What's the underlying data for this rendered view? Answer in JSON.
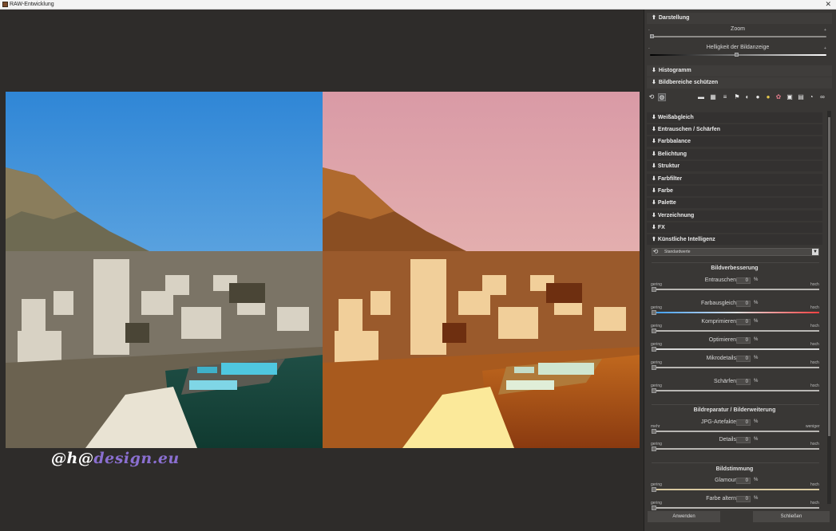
{
  "window": {
    "title": "RAW-Entwicklung",
    "close_glyph": "✕"
  },
  "watermark": {
    "part1": "@h@",
    "part2": "design.eu"
  },
  "sections": {
    "darstellung": "Darstellung",
    "zoom_label": "Zoom",
    "zoom_min": "-",
    "zoom_max": "+",
    "helligkeit_label": "Helligkeit der Bildanzeige",
    "hell_min": "-",
    "hell_max": "+",
    "histogramm": "Histogramm",
    "schuetzen": "Bildbereiche schützen"
  },
  "toolbar_icons": [
    "undo-icon",
    "settings-icon",
    "stripe-icon",
    "crop-icon",
    "lines-icon",
    "flag-icon",
    "contrast-icon",
    "color-icon",
    "sun-icon",
    "palette-icon",
    "camera-icon",
    "image-icon",
    "chat-icon",
    "glasses-icon"
  ],
  "subsections": [
    "Weißabgleich",
    "Entrauschen / Schärfen",
    "Farbbalance",
    "Belichtung",
    "Struktur",
    "Farbfilter",
    "Farbe",
    "Palette",
    "Verzeichnung",
    "FX",
    "Künstliche Intelligenz"
  ],
  "ai": {
    "preset": "Standardwerte",
    "group1_title": "Bildverbesserung",
    "group2_title": "Bildreparatur / Bilderweiterung",
    "group3_title": "Bildstimmung",
    "low": "gering",
    "high": "hoch",
    "more": "mehr",
    "less": "weniger",
    "pct": "%",
    "sliders": [
      {
        "label": "Entrauschen",
        "value": "0"
      },
      {
        "label": "Farbausgleich",
        "value": "0"
      },
      {
        "label": "Komprimieren",
        "value": "0"
      },
      {
        "label": "Optimieren",
        "value": "0"
      },
      {
        "label": "Mikrodetails",
        "value": "0"
      },
      {
        "label": "Schärfen",
        "value": "0"
      },
      {
        "label": "JPG-Artefakte",
        "value": "0"
      },
      {
        "label": "Details",
        "value": "0"
      },
      {
        "label": "Glamour",
        "value": "0"
      },
      {
        "label": "Farbe altern",
        "value": "0"
      }
    ]
  },
  "buttons": {
    "apply": "Anwenden",
    "close": "Schließen"
  }
}
